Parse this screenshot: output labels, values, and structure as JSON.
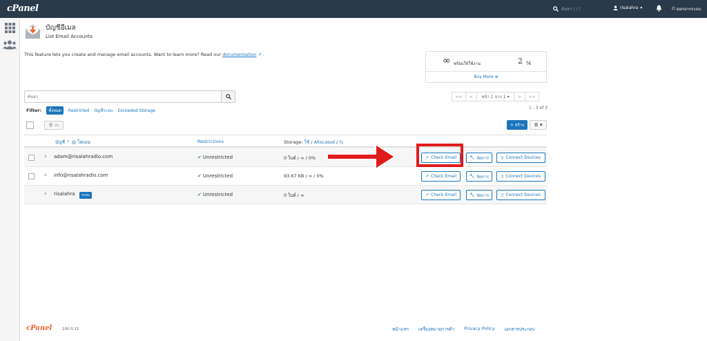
{
  "topbar": {
    "brand": "cPanel",
    "search_placeholder": "ค้นหา ( / )",
    "username": "risalahra",
    "logout": "ออกจากระบบ"
  },
  "header": {
    "title": "บัญชีอีเมล",
    "subtitle": "List Email Accounts"
  },
  "intro": {
    "text": "This feature lets you create and manage email accounts. Want to learn more? Read our",
    "link": "documentation",
    "suffix": "."
  },
  "stats": {
    "available_symbol": "∞",
    "available_label": "พร้อมให้ใช้งาน",
    "used_value": "2",
    "used_label": "ใช้",
    "buy_more": "Buy More ⊕"
  },
  "search": {
    "placeholder": "ค้นหา"
  },
  "pagination": {
    "first": "<<",
    "prev": "<",
    "page_label": "หน้า 1 จาก 1 ▾",
    "next": ">",
    "last": ">>",
    "range": "1 - 3 of 3"
  },
  "filter": {
    "label": "Filter:",
    "options": [
      "ทั้งหมด",
      "Restricted",
      "บัญชีระบบ",
      "Exceeded Storage"
    ]
  },
  "actions": {
    "delete": "ลบ",
    "create": "+ สร้าง",
    "gear": "⚙ ▾"
  },
  "table": {
    "col_account": "บัญชี ^ @ โดเมน",
    "col_restrictions": "Restrictions",
    "col_storage_prefix": "Storage: ",
    "col_storage_used": "ใช้",
    "col_storage_sep1": " / ",
    "col_storage_allocated": "Allocated",
    "col_storage_sep2": " / ",
    "col_storage_pct": "%",
    "rows": [
      {
        "account": "adam@risalahradio.com",
        "restriction": "Unrestricted",
        "storage": "0 ไบต์ / ∞ / 0%"
      },
      {
        "account": "info@risalahradio.com",
        "restriction": "Unrestricted",
        "storage": "93.67 KB / ∞ / 0%"
      },
      {
        "account": "risalahra",
        "tag": "ระบบ",
        "restriction": "Unrestricted",
        "storage": "0 ไบต์ / ∞"
      }
    ],
    "btn_check": "Check Email",
    "btn_manage": "จัดการ",
    "btn_connect": "Connect Devices"
  },
  "footer": {
    "brand": "cPanel",
    "version": "100.0.11",
    "links": [
      "หน้าแรก",
      "เครื่องหมายการค้า",
      "Privacy Policy",
      "เอกสารประกอบ"
    ]
  },
  "colors": {
    "topbar": "#293a4a",
    "accent": "#1b75bb",
    "highlight": "#e01b1b",
    "success": "#3c9a3c",
    "footer_brand": "#e8632b"
  }
}
